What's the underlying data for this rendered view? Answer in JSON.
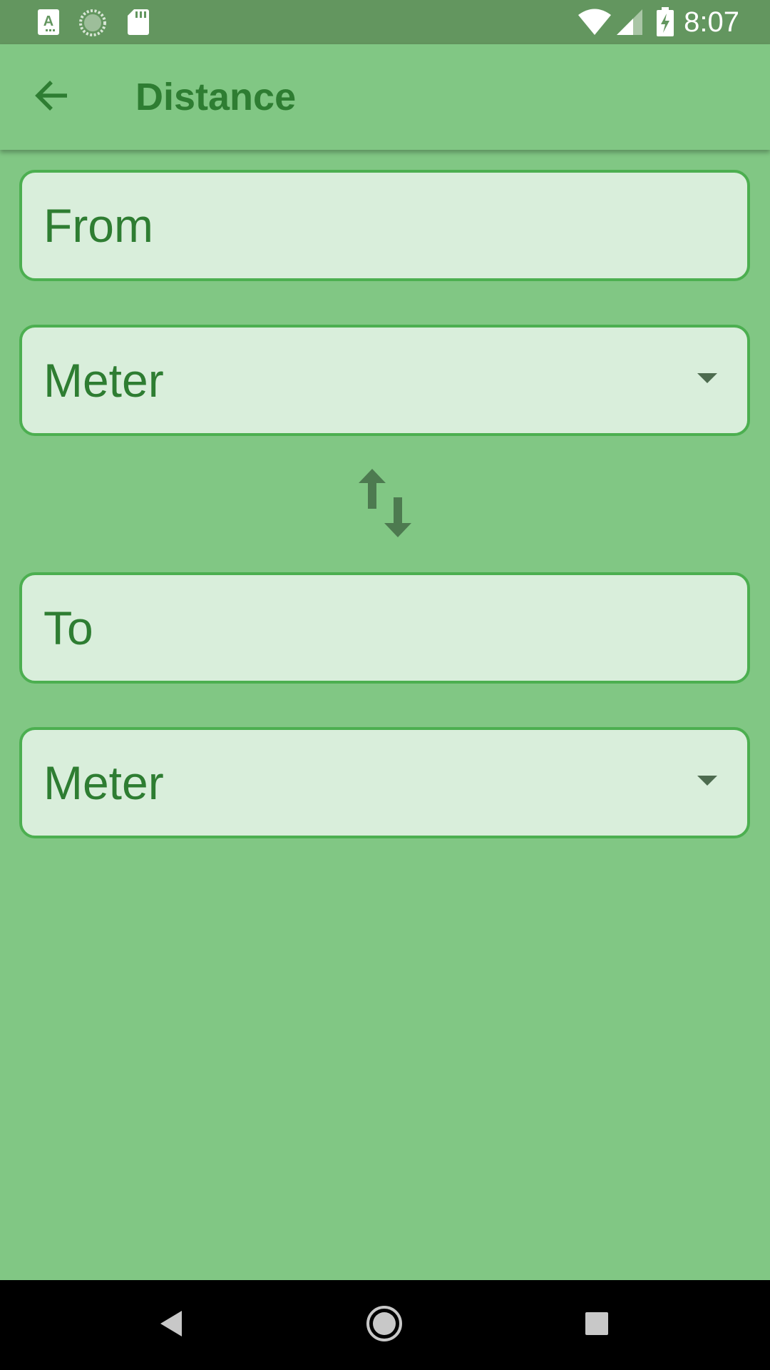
{
  "status_bar": {
    "time": "8:07",
    "left_icons": [
      "text-a-icon",
      "sync-circle-icon",
      "sd-card-icon"
    ],
    "right_icons": [
      "wifi-icon",
      "cell-signal-icon",
      "battery-charging-icon"
    ]
  },
  "app_bar": {
    "title": "Distance",
    "back_icon": "arrow-back-icon"
  },
  "from": {
    "input_placeholder": "From",
    "unit_selected": "Meter"
  },
  "to": {
    "input_placeholder": "To",
    "unit_selected": "Meter"
  },
  "swap_icon": "swap-vertical-icon",
  "nav_bar": {
    "icons": [
      "nav-back-icon",
      "nav-home-icon",
      "nav-recents-icon"
    ]
  },
  "colors": {
    "background": "#81c784",
    "status_bar": "#63965f",
    "accent_text": "#2e7d32",
    "field_fill": "#d9eedb",
    "field_border": "#4caf50",
    "icon_dark": "#4d7a50"
  }
}
